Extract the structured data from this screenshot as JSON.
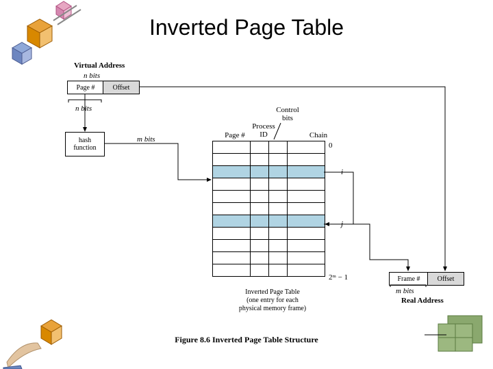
{
  "title": "Inverted Page Table",
  "virtual_address_label": "Virtual Address",
  "n_bits": "n bits",
  "m_bits": "m bits",
  "page_num": "Page #",
  "offset": "Offset",
  "hash_function": "hash\nfunction",
  "control_bits": "Control\nbits",
  "process_id": "Process\nID",
  "chain": "Chain",
  "row_labels": {
    "zero": "0",
    "i": "i",
    "j": "j",
    "last": "2ᵐ − 1"
  },
  "table_caption": "Inverted Page Table\n(one entry for each\nphysical memory frame)",
  "frame_num": "Frame #",
  "real_address": "Real Address",
  "figure_caption": "Figure 8.6   Inverted Page Table Structure"
}
